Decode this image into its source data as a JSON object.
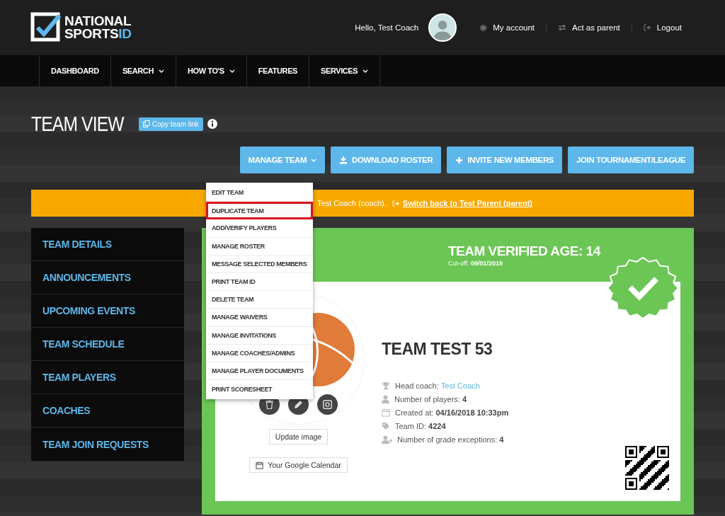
{
  "header": {
    "logo": {
      "line1": "NATIONAL",
      "line2": "SPORTS",
      "line2_accent": "ID"
    },
    "greeting": "Hello, Test Coach",
    "links": [
      {
        "kind": "account",
        "label": "My account"
      },
      {
        "kind": "switch",
        "label": "Act as parent"
      },
      {
        "kind": "logout",
        "label": "Logout"
      }
    ]
  },
  "nav": [
    {
      "label": "DASHBOARD",
      "caret": false
    },
    {
      "label": "SEARCH",
      "caret": true
    },
    {
      "label": "HOW TO'S",
      "caret": true
    },
    {
      "label": "FEATURES",
      "caret": false
    },
    {
      "label": "SERVICES",
      "caret": true
    }
  ],
  "page_title": "TEAM VIEW",
  "copy_link": "Copy team link",
  "actions": [
    {
      "kind": "dropdown",
      "label": "MANAGE TEAM"
    },
    {
      "kind": "download",
      "label": "DOWNLOAD ROSTER"
    },
    {
      "kind": "plus",
      "label": "INVITE NEW MEMBERS"
    },
    {
      "kind": "plain",
      "label": "JOIN TOURNAMENT/LEAGUE"
    }
  ],
  "manage_menu": [
    {
      "label": "EDIT TEAM",
      "selected": false
    },
    {
      "label": "DUPLICATE TEAM",
      "selected": true
    },
    {
      "label": "ADD/VERIFY PLAYERS",
      "selected": false
    },
    {
      "label": "MANAGE ROSTER",
      "selected": false
    },
    {
      "label": "MESSAGE SELECTED MEMBERS",
      "selected": false
    },
    {
      "label": "PRINT TEAM ID",
      "selected": false
    },
    {
      "label": "DELETE TEAM",
      "selected": false
    },
    {
      "label": "MANAGE WAIVERS",
      "selected": false
    },
    {
      "label": "MANAGE INVITATIONS",
      "selected": false
    },
    {
      "label": "MANAGE COACHES/ADMINS",
      "selected": false
    },
    {
      "label": "MANAGE PLAYER DOCUMENTS",
      "selected": false
    },
    {
      "label": "PRINT SCORESHEET",
      "selected": false
    }
  ],
  "banner": {
    "text": "Test Coach (coach).",
    "link": "Switch back to Test Parent (parent)"
  },
  "sidebar": [
    "TEAM DETAILS",
    "ANNOUNCEMENTS",
    "UPCOMING EVENTS",
    "TEAM SCHEDULE",
    "TEAM PLAYERS",
    "COACHES",
    "TEAM JOIN REQUESTS"
  ],
  "team": {
    "verified_age": "TEAM VERIFIED AGE: 14",
    "cutoff_label": "Cut-off:",
    "cutoff": "09/01/2019",
    "name": "TEAM TEST 53",
    "update_image": "Update image",
    "calendar": "Your Google Calendar",
    "details": [
      {
        "kind": "trophy",
        "label": "Head coach:",
        "value": "Test Coach",
        "linked": true
      },
      {
        "kind": "person",
        "label": "Number of players:",
        "value": "4",
        "linked": false
      },
      {
        "kind": "calendar",
        "label": "Created at:",
        "value": "04/16/2018 10:33pm",
        "linked": false
      },
      {
        "kind": "tag",
        "label": "Team ID:",
        "value": "4224",
        "linked": false
      },
      {
        "kind": "person-add",
        "label": "Number of grade exceptions:",
        "value": "4",
        "linked": false
      }
    ]
  }
}
